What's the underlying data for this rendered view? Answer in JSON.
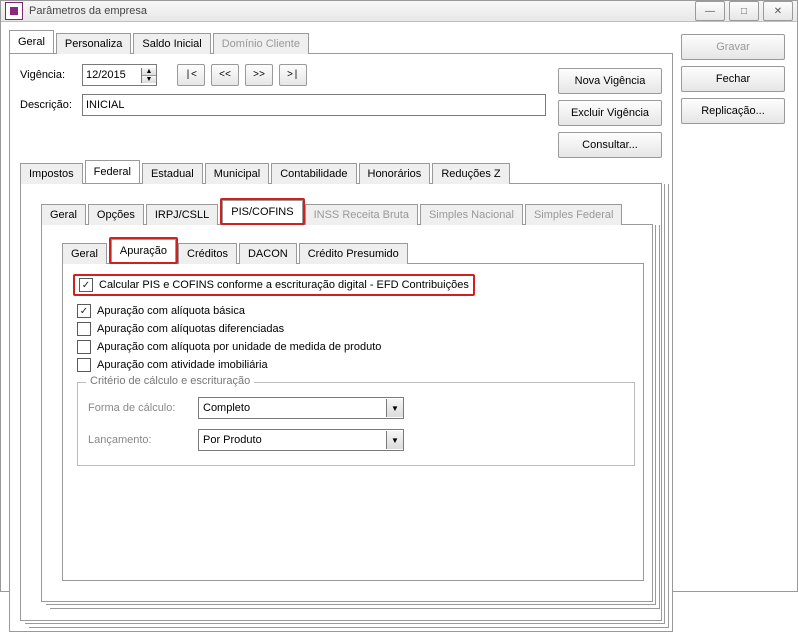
{
  "window": {
    "title": "Parâmetros da empresa"
  },
  "top_tabs": {
    "geral": "Geral",
    "personaliza": "Personaliza",
    "saldo": "Saldo Inicial",
    "dominio": "Domínio Cliente"
  },
  "vigencia": {
    "label": "Vigência:",
    "value": "12/2015",
    "nav_first": "|<",
    "nav_prev": "<<",
    "nav_next": ">>",
    "nav_last": ">|"
  },
  "descricao": {
    "label": "Descrição:",
    "value": "INICIAL"
  },
  "side_buttons": {
    "nova": "Nova Vigência",
    "excluir": "Excluir Vigência",
    "consultar": "Consultar..."
  },
  "right_buttons": {
    "gravar": "Gravar",
    "fechar": "Fechar",
    "replicacao": "Replicação..."
  },
  "tax_tabs": {
    "impostos": "Impostos",
    "federal": "Federal",
    "estadual": "Estadual",
    "municipal": "Municipal",
    "contabilidade": "Contabilidade",
    "honorarios": "Honorários",
    "reducoes": "Reduções Z"
  },
  "fed_tabs": {
    "geral": "Geral",
    "opcoes": "Opções",
    "irpj": "IRPJ/CSLL",
    "pis": "PIS/COFINS",
    "inss": "INSS Receita Bruta",
    "simplesn": "Simples Nacional",
    "simplesf": "Simples Federal"
  },
  "pis_tabs": {
    "geral": "Geral",
    "apuracao": "Apuração",
    "creditos": "Créditos",
    "dacon": "DACON",
    "credpres": "Crédito Presumido"
  },
  "checks": {
    "efd": "Calcular PIS e COFINS conforme a escrituração digital - EFD Contribuições",
    "basica": "Apuração com alíquota básica",
    "difer": "Apuração com alíquotas diferenciadas",
    "unidade": "Apuração com alíquota por unidade de medida de produto",
    "imob": "Apuração com atividade imobiliária"
  },
  "group": {
    "title": "Critério de cálculo e escrituração",
    "forma_label": "Forma de cálculo:",
    "forma_value": "Completo",
    "lanc_label": "Lançamento:",
    "lanc_value": "Por Produto"
  }
}
